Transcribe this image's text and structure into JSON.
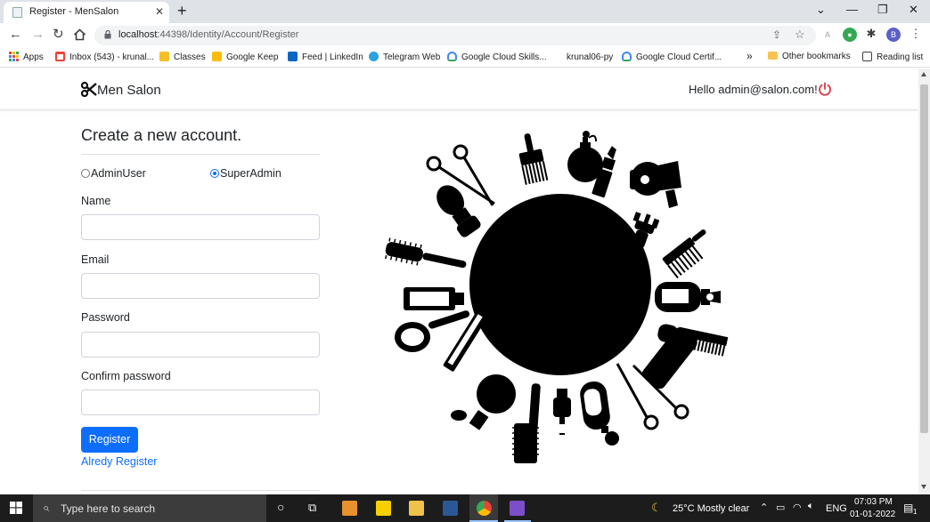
{
  "browser": {
    "tab_title": "Register - MenSalon",
    "tab_close": "✕",
    "new_tab": "+",
    "url_host": "localhost",
    "url_rest": ":44398/Identity/Account/Register",
    "profile_initial": "B",
    "window_controls": {
      "minimize": "—",
      "restore": "❐",
      "close": "✕",
      "tab_search": "⌄"
    }
  },
  "bookmarks": [
    {
      "label": "Apps",
      "color": "#e8453c"
    },
    {
      "label": "Inbox (543) - krunal...",
      "color": "#ea4335"
    },
    {
      "label": "Classes",
      "color": "#f6bf26"
    },
    {
      "label": "Google Keep",
      "color": "#fbbc04"
    },
    {
      "label": "Feed | LinkedIn",
      "color": "#0a66c2"
    },
    {
      "label": "Telegram Web",
      "color": "#2aa3df"
    },
    {
      "label": "Google Cloud Skills...",
      "color": "#4285f4"
    },
    {
      "label": "krunal06-py",
      "color": "#ffffff"
    },
    {
      "label": "Google Cloud Certif...",
      "color": "#4285f4"
    }
  ],
  "bookmarks_more": "»",
  "other_bookmarks": "Other bookmarks",
  "reading_list": "Reading list",
  "navbar": {
    "brand": "Men Salon",
    "greeting": "Hello admin@salon.com!"
  },
  "form": {
    "title": "Create a new account.",
    "roles": [
      {
        "label": "AdminUser",
        "checked": false
      },
      {
        "label": "SuperAdmin",
        "checked": true
      }
    ],
    "name_label": "Name",
    "email_label": "Email",
    "password_label": "Password",
    "confirm_label": "Confirm password",
    "name_value": "",
    "email_value": "",
    "password_value": "",
    "confirm_value": "",
    "submit_label": "Register",
    "login_link": "Alredy Register"
  },
  "taskbar": {
    "search_placeholder": "Type here to search",
    "weather": "25°C  Mostly clear",
    "language": "ENG",
    "time": "07:03 PM",
    "date": "01-01-2022",
    "notification_count": "1"
  },
  "colors": {
    "primary": "#0d6efd",
    "logout": "#dc3545"
  }
}
